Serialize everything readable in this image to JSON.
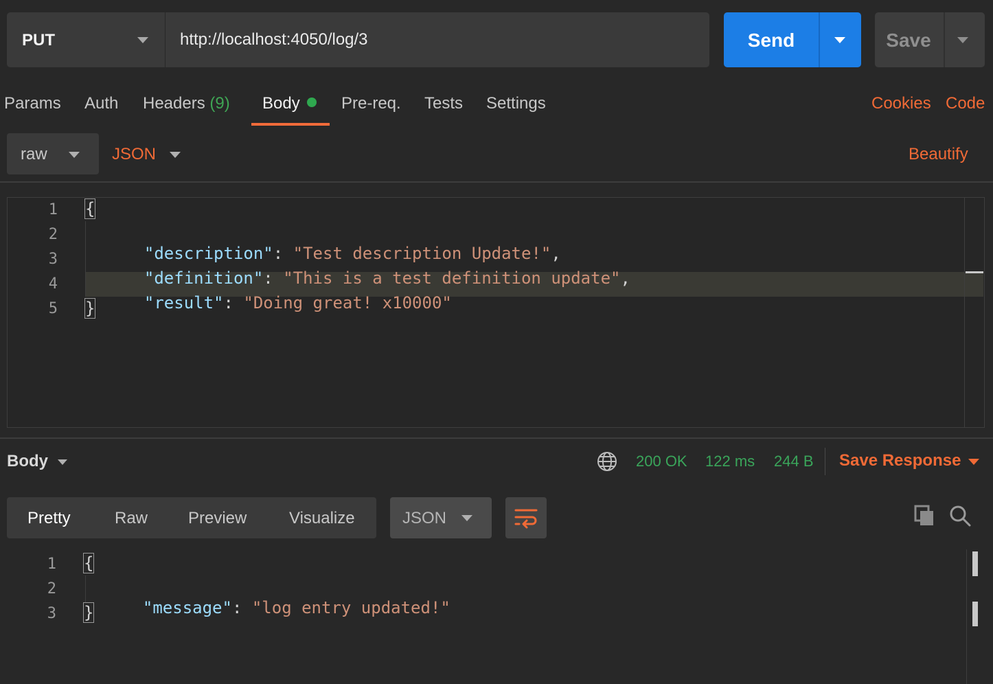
{
  "request": {
    "method": "PUT",
    "url": "http://localhost:4050/log/3",
    "send_label": "Send",
    "save_label": "Save"
  },
  "tabs": {
    "params": "Params",
    "auth": "Auth",
    "headers": "Headers",
    "headers_count": "(9)",
    "body": "Body",
    "prereq": "Pre-req.",
    "tests": "Tests",
    "settings": "Settings",
    "cookies": "Cookies",
    "code": "Code"
  },
  "body_options": {
    "mode": "raw",
    "language": "JSON",
    "beautify": "Beautify"
  },
  "editor": {
    "line_numbers": [
      "1",
      "2",
      "3",
      "4",
      "5"
    ],
    "open_brace": "{",
    "close_brace": "}",
    "lines": [
      {
        "key": "\"description\"",
        "value": "\"Test description Update!\"",
        "trail": ","
      },
      {
        "key": "\"definition\"",
        "value": "\"This is a test definition update\"",
        "trail": ","
      },
      {
        "key": "\"result\"",
        "value": "\"Doing great! x10000\"",
        "trail": ""
      }
    ]
  },
  "response": {
    "section_label": "Body",
    "status": "200 OK",
    "time": "122 ms",
    "size": "244 B",
    "save_response": "Save Response",
    "views": [
      "Pretty",
      "Raw",
      "Preview",
      "Visualize"
    ],
    "language": "JSON",
    "line_numbers": [
      "1",
      "2",
      "3"
    ],
    "open_brace": "{",
    "close_brace": "}",
    "line_key": "\"message\"",
    "line_value": "\"log entry updated!\""
  },
  "colors": {
    "accent_orange": "#f06a36",
    "send_blue": "#1c7ee6",
    "status_green": "#3aa55a",
    "json_key": "#9cdcfe",
    "json_string": "#ce9178"
  }
}
